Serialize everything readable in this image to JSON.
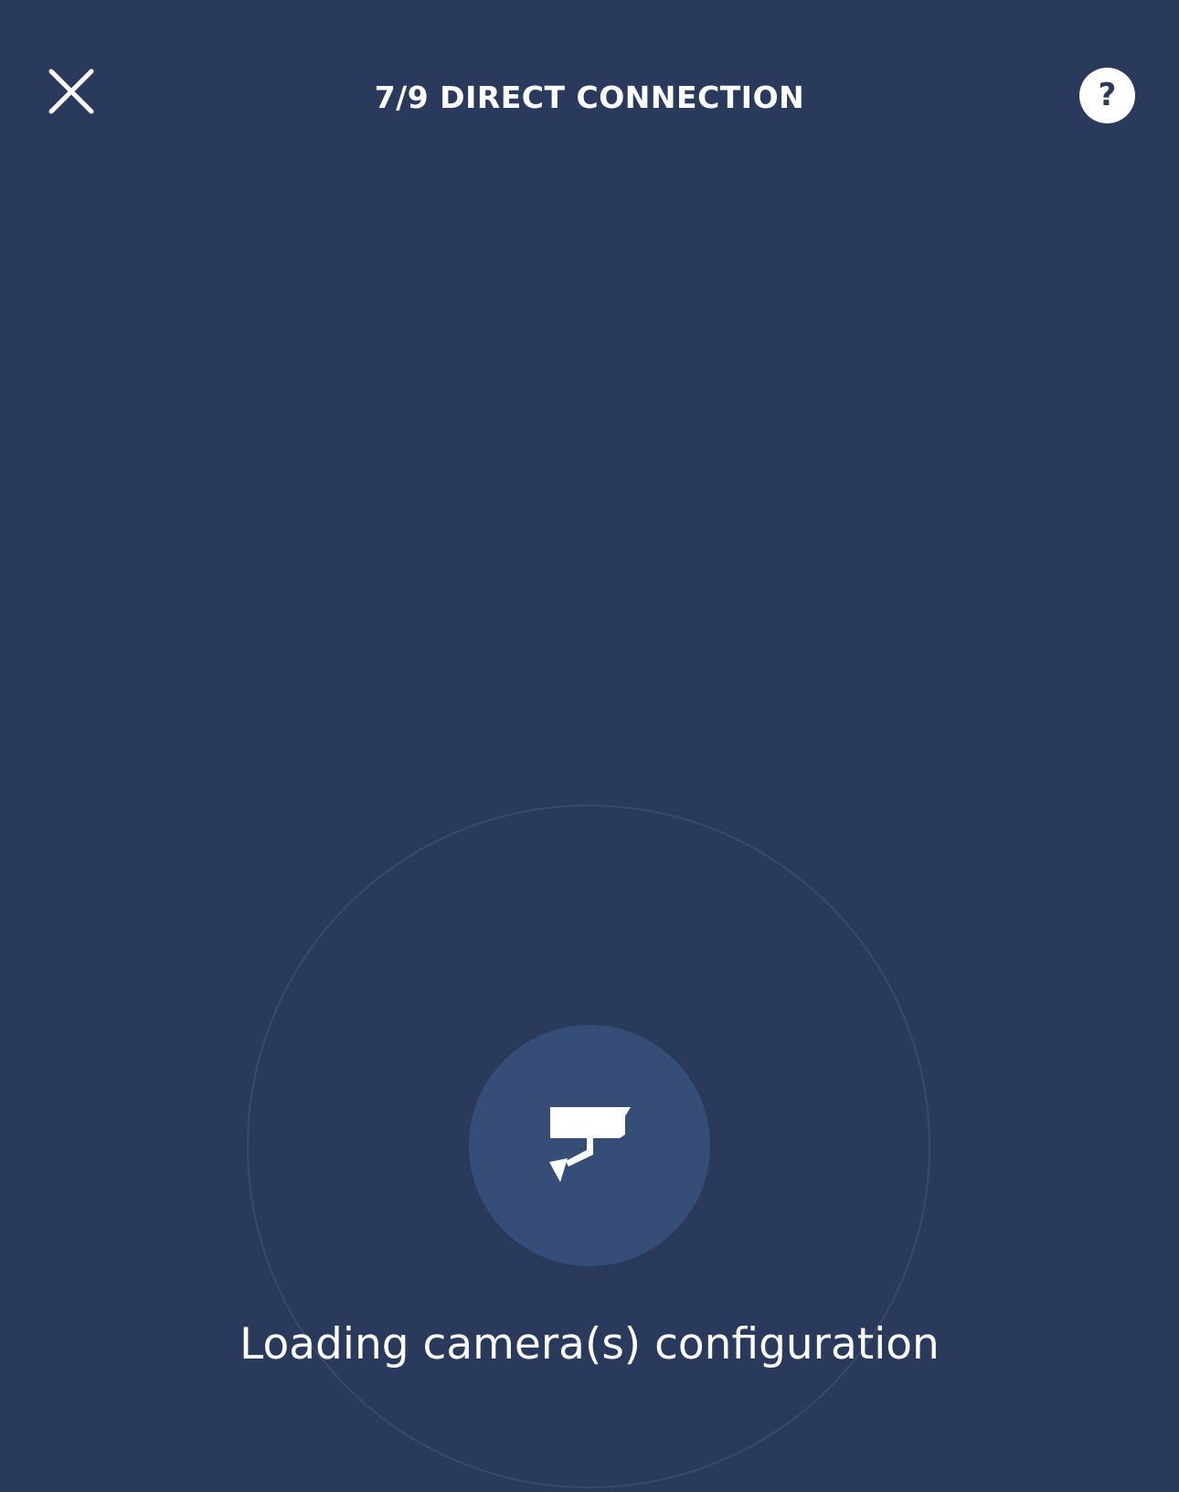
{
  "header": {
    "title": "7/9 DIRECT CONNECTION",
    "close_icon": "close-icon",
    "help_icon": "help-icon",
    "help_glyph": "?"
  },
  "main": {
    "status_text": "Loading camera(s) configuration",
    "status_icon": "security-camera-icon"
  },
  "colors": {
    "background": "#2a3a5c",
    "inner_circle": "#364d77",
    "ring": "#3b4a6b",
    "foreground": "#ffffff"
  }
}
